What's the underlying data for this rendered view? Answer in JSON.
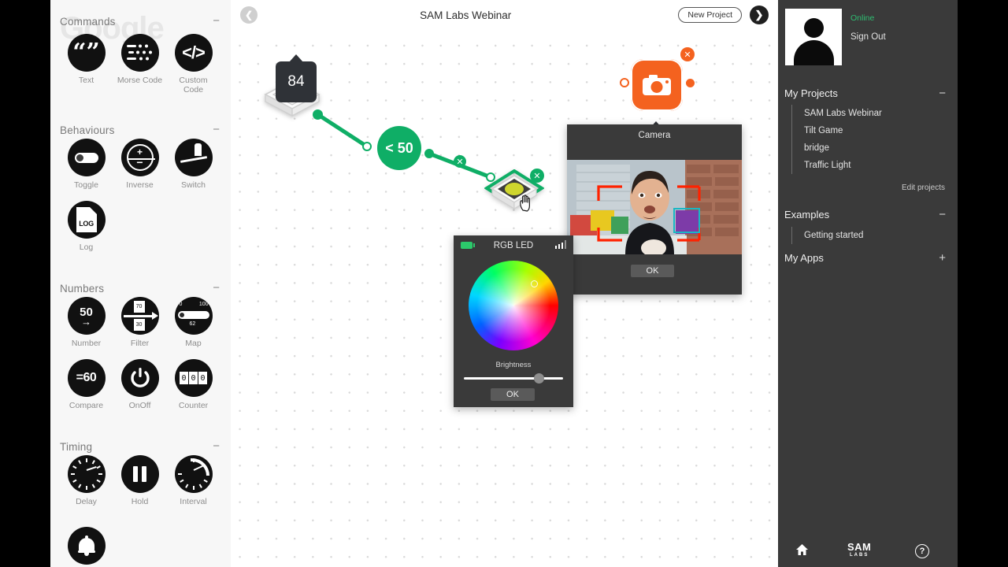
{
  "app": {
    "watermark_text": "Google"
  },
  "header": {
    "back_icon": "chevron-left-icon",
    "title": "SAM Labs Webinar",
    "new_project_label": "New Project",
    "forward_icon": "chevron-right-icon"
  },
  "palette": {
    "sections": [
      {
        "title": "Commands",
        "collapse": "−",
        "items": [
          {
            "label": "Text",
            "icon": "quote-icon"
          },
          {
            "label": "Morse Code",
            "icon": "morse-code-icon"
          },
          {
            "label": "Custom Code",
            "icon": "angle-brackets-icon"
          }
        ]
      },
      {
        "title": "Behaviours",
        "collapse": "−",
        "items": [
          {
            "label": "Toggle",
            "icon": "toggle-switch-icon"
          },
          {
            "label": "Inverse",
            "icon": "plus-minus-icon",
            "plus": "+",
            "minus": "−"
          },
          {
            "label": "Switch",
            "icon": "hand-switch-icon"
          },
          {
            "label": "Log",
            "icon": "log-document-icon",
            "glyph": "LOG"
          }
        ]
      },
      {
        "title": "Numbers",
        "collapse": "−",
        "items": [
          {
            "label": "Number",
            "icon": "number-icon",
            "value": "50",
            "arrow": "→"
          },
          {
            "label": "Filter",
            "icon": "filter-icon",
            "high": "70",
            "low": "30"
          },
          {
            "label": "Map",
            "icon": "map-range-icon",
            "min": "0",
            "max": "100",
            "current": "62"
          },
          {
            "label": "Compare",
            "icon": "compare-icon",
            "value": "=60"
          },
          {
            "label": "OnOff",
            "icon": "power-icon"
          },
          {
            "label": "Counter",
            "icon": "counter-icon",
            "digits": [
              "0",
              "0",
              "0"
            ]
          }
        ]
      },
      {
        "title": "Timing",
        "collapse": "−",
        "items": [
          {
            "label": "Delay",
            "icon": "clock-delay-icon"
          },
          {
            "label": "Hold",
            "icon": "pause-icon"
          },
          {
            "label": "Interval",
            "icon": "interval-clock-icon"
          },
          {
            "label": "",
            "icon": "bell-alert-icon"
          }
        ]
      }
    ]
  },
  "canvas": {
    "light_sensor": {
      "name": "light-sensor-block",
      "reading": "84"
    },
    "condition_node": {
      "label": "< 50"
    },
    "rgb_led_block": {
      "name": "rgb-led-block",
      "close": "✕"
    },
    "camera_node": {
      "label": "Camera",
      "close": "✕",
      "icon": "camera-icon"
    },
    "link_delete": "✕"
  },
  "rgb_dialog": {
    "title": "RGB LED",
    "battery_icon": "battery-icon",
    "signal_icon": "signal-bars-icon",
    "brightness_label": "Brightness",
    "brightness_value": 80,
    "ok_label": "OK"
  },
  "camera_dialog": {
    "title": "Camera",
    "ok_label": "OK"
  },
  "sidebar": {
    "avatar": "user-avatar",
    "status": "Online",
    "sign_out": "Sign Out",
    "groups": [
      {
        "title": "My Projects",
        "sign": "−",
        "items": [
          "SAM Labs Webinar",
          "Tilt Game",
          "bridge",
          "Traffic Light"
        ],
        "footer": "Edit projects"
      },
      {
        "title": "Examples",
        "sign": "−",
        "items": [
          "Getting started"
        ]
      },
      {
        "title": "My Apps",
        "sign": "+",
        "items": []
      }
    ],
    "bottom": {
      "home_icon": "home-icon",
      "logo_line1": "SAM",
      "logo_line2": "LABS",
      "help_label": "?"
    }
  },
  "colors": {
    "green": "#0fae66",
    "orange": "#f4621f",
    "panel_dark": "#3a3a3a",
    "panel_light": "#f7f7f7",
    "online_green": "#2fbd72"
  }
}
